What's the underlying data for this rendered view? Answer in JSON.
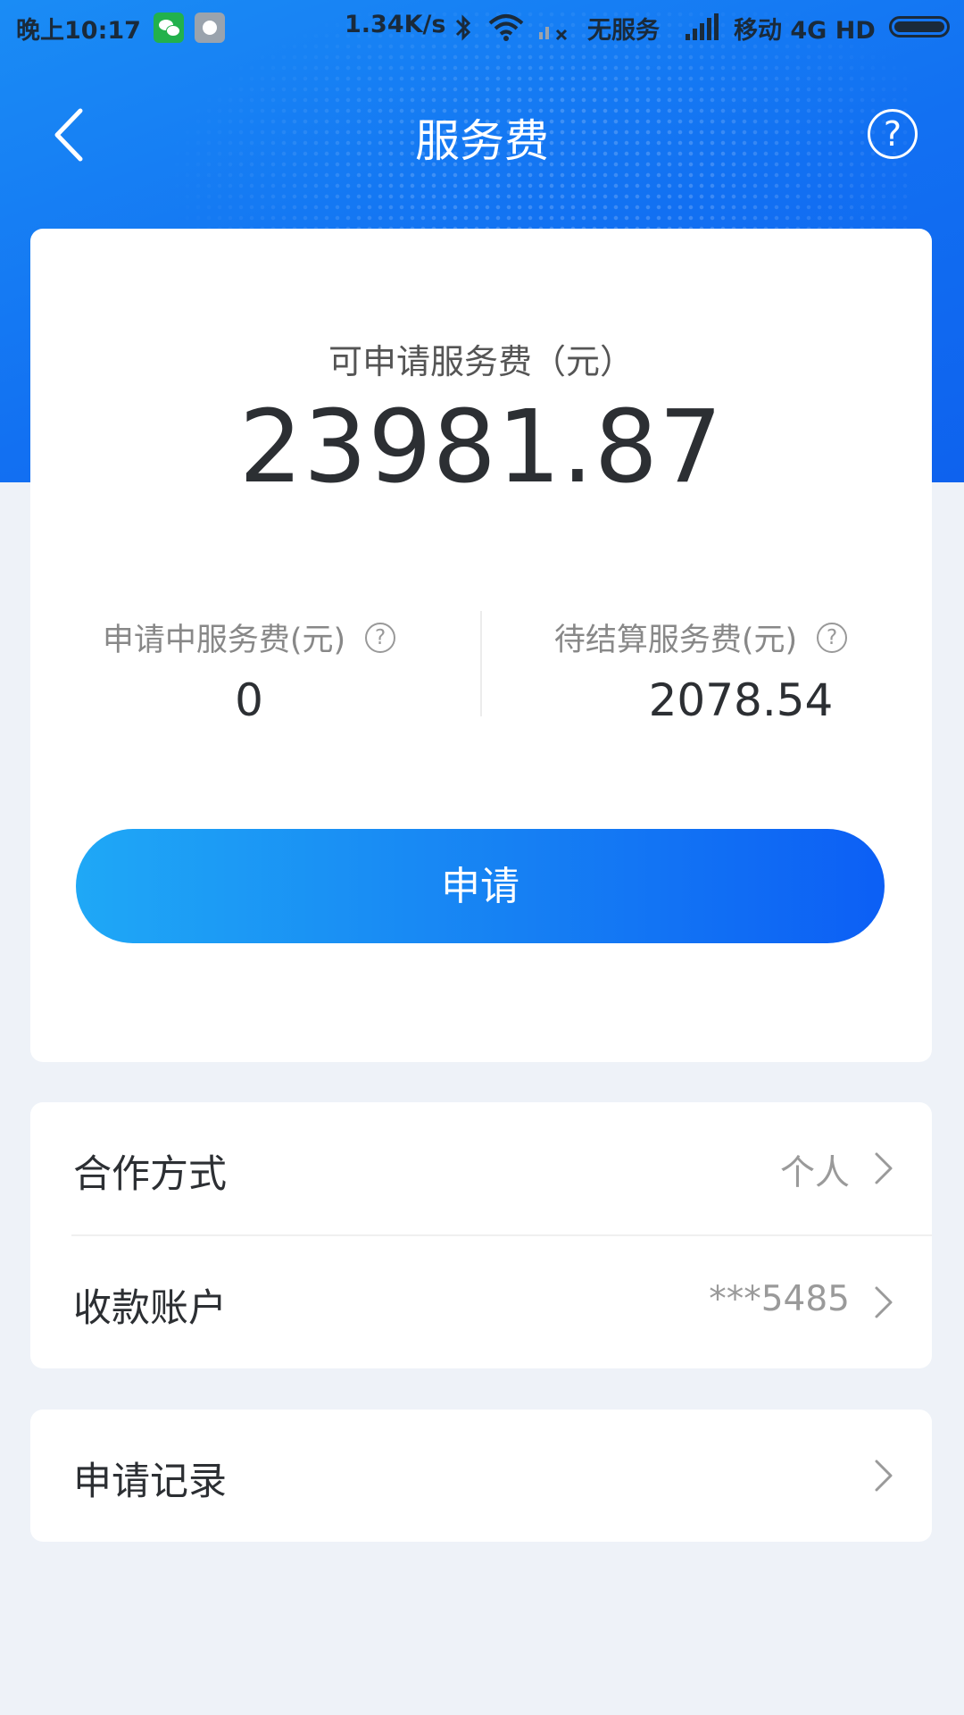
{
  "status_bar": {
    "time": "晚上10:17",
    "speed": "1.34K/s",
    "no_service": "无服务",
    "carrier": "移动 4G HD"
  },
  "nav": {
    "title": "服务费",
    "help": "?"
  },
  "summary": {
    "available_label": "可申请服务费（元）",
    "available_amount": "23981.87",
    "pending_label": "申请中服务费(元)",
    "pending_value": "0",
    "settling_label": "待结算服务费(元)",
    "settling_value": "2078.54",
    "help_glyph": "?",
    "apply_label": "申请"
  },
  "list": {
    "cooperation_label": "合作方式",
    "cooperation_value": "个人",
    "account_label": "收款账户",
    "account_value": "***5485",
    "records_label": "申请记录"
  },
  "colors": {
    "primary": "#1270f2",
    "button_start": "#1fa8f6",
    "button_end": "#0c5ff5"
  }
}
